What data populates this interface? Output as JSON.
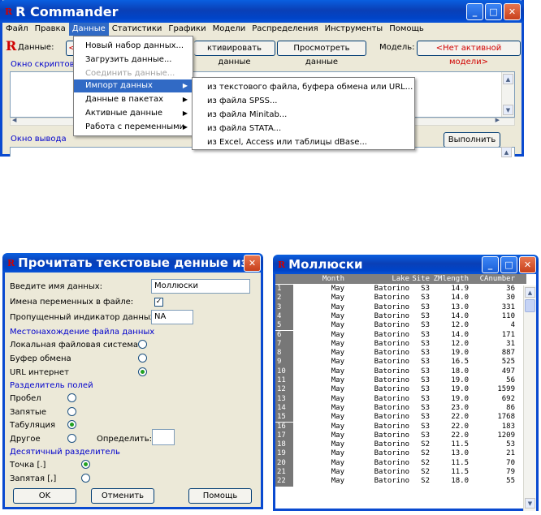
{
  "main_window": {
    "title": "R Commander",
    "logo": "R",
    "minimize": "_",
    "maximize": "□",
    "close": "✕",
    "menu": [
      "Файл",
      "Правка",
      "Данные",
      "Статистики",
      "Графики",
      "Модели",
      "Распределения",
      "Инструменты",
      "Помощь"
    ],
    "toolbar": {
      "logo": "R",
      "data_label": "Данные:",
      "data_value": "<",
      "activate_button": "ктивировать данные",
      "view_button": "Просмотреть данные",
      "model_label": "Модель:",
      "model_value": "<Нет активной модели>"
    },
    "script_window_label": "Окно скриптов",
    "output_window_label": "Окно вывода",
    "run_button": "Выполнить"
  },
  "data_menu": {
    "items": [
      {
        "label": "Новый набор данных...",
        "state": "normal"
      },
      {
        "label": "Загрузить данные...",
        "state": "normal"
      },
      {
        "label": "Соединить данные...",
        "state": "disabled"
      },
      {
        "label": "Импорт данных",
        "state": "highlight",
        "submenu": true
      },
      {
        "label": "Данные в пакетах",
        "state": "normal",
        "submenu": true
      },
      {
        "label": "Активные данные",
        "state": "normal",
        "submenu": true
      },
      {
        "label": "Работа с переменными",
        "state": "normal",
        "submenu": true
      }
    ]
  },
  "import_submenu": {
    "items": [
      "из текстового файла, буфера обмена или URL...",
      "из файла SPSS...",
      "из файла Minitab...",
      "из файла STATA...",
      "из Excel, Access или таблицы dBase..."
    ]
  },
  "dialog": {
    "title": "Прочитать текстовые денные из...",
    "close": "✕",
    "name_label": "Введите имя данных:",
    "name_value": "Моллюски",
    "varnames_label": "Имена переменных в файле:",
    "varnames_check": "✓",
    "na_label": "Пропущенный индикатор данных:",
    "na_value": "NA",
    "location_header": "Местонахождение файла данных",
    "loc_local": "Локальная файловая система",
    "loc_clipboard": "Буфер обмена",
    "loc_url": "URL интернет",
    "sep_header": "Разделитель полей",
    "sep_space": "Пробел",
    "sep_comma": "Запятые",
    "sep_tab": "Табуляция",
    "sep_other": "Другое",
    "sep_define": "Определить:",
    "dec_header": "Десятичный разделитель",
    "dec_point": "Точка [.]",
    "dec_comma": "Запятая [,]",
    "ok": "OK",
    "cancel": "Отменить",
    "help": "Помощь"
  },
  "data_window": {
    "title": "Моллюски",
    "minimize": "_",
    "maximize": "□",
    "close": "✕",
    "columns": [
      "Month",
      "Lake",
      "Site",
      "ZMlength",
      "CAnumber"
    ],
    "rows": [
      [
        "1",
        "May",
        "Batorino",
        "S3",
        "14.9",
        "36"
      ],
      [
        "2",
        "May",
        "Batorino",
        "S3",
        "14.0",
        "30"
      ],
      [
        "3",
        "May",
        "Batorino",
        "S3",
        "13.0",
        "331"
      ],
      [
        "4",
        "May",
        "Batorino",
        "S3",
        "14.0",
        "110"
      ],
      [
        "5",
        "May",
        "Batorino",
        "S3",
        "12.0",
        "4"
      ],
      [
        "6",
        "May",
        "Batorino",
        "S3",
        "14.0",
        "171"
      ],
      [
        "7",
        "May",
        "Batorino",
        "S3",
        "12.0",
        "31"
      ],
      [
        "8",
        "May",
        "Batorino",
        "S3",
        "19.0",
        "887"
      ],
      [
        "9",
        "May",
        "Batorino",
        "S3",
        "16.5",
        "525"
      ],
      [
        "10",
        "May",
        "Batorino",
        "S3",
        "18.0",
        "497"
      ],
      [
        "11",
        "May",
        "Batorino",
        "S3",
        "19.0",
        "56"
      ],
      [
        "12",
        "May",
        "Batorino",
        "S3",
        "19.0",
        "1599"
      ],
      [
        "13",
        "May",
        "Batorino",
        "S3",
        "19.0",
        "692"
      ],
      [
        "14",
        "May",
        "Batorino",
        "S3",
        "23.0",
        "86"
      ],
      [
        "15",
        "May",
        "Batorino",
        "S3",
        "22.0",
        "1768"
      ],
      [
        "16",
        "May",
        "Batorino",
        "S3",
        "22.0",
        "183"
      ],
      [
        "17",
        "May",
        "Batorino",
        "S3",
        "22.0",
        "1209"
      ],
      [
        "18",
        "May",
        "Batorino",
        "S2",
        "11.5",
        "53"
      ],
      [
        "19",
        "May",
        "Batorino",
        "S2",
        "13.0",
        "21"
      ],
      [
        "20",
        "May",
        "Batorino",
        "S2",
        "11.5",
        "70"
      ],
      [
        "21",
        "May",
        "Batorino",
        "S2",
        "11.5",
        "79"
      ],
      [
        "22",
        "May",
        "Batorino",
        "S2",
        "18.0",
        "55"
      ]
    ]
  },
  "colors": {
    "titlebar": "#0a4ad0",
    "highlight": "#316ac5",
    "face": "#ece9d8",
    "accent_red": "#d10000",
    "section_blue": "#0000cc"
  }
}
